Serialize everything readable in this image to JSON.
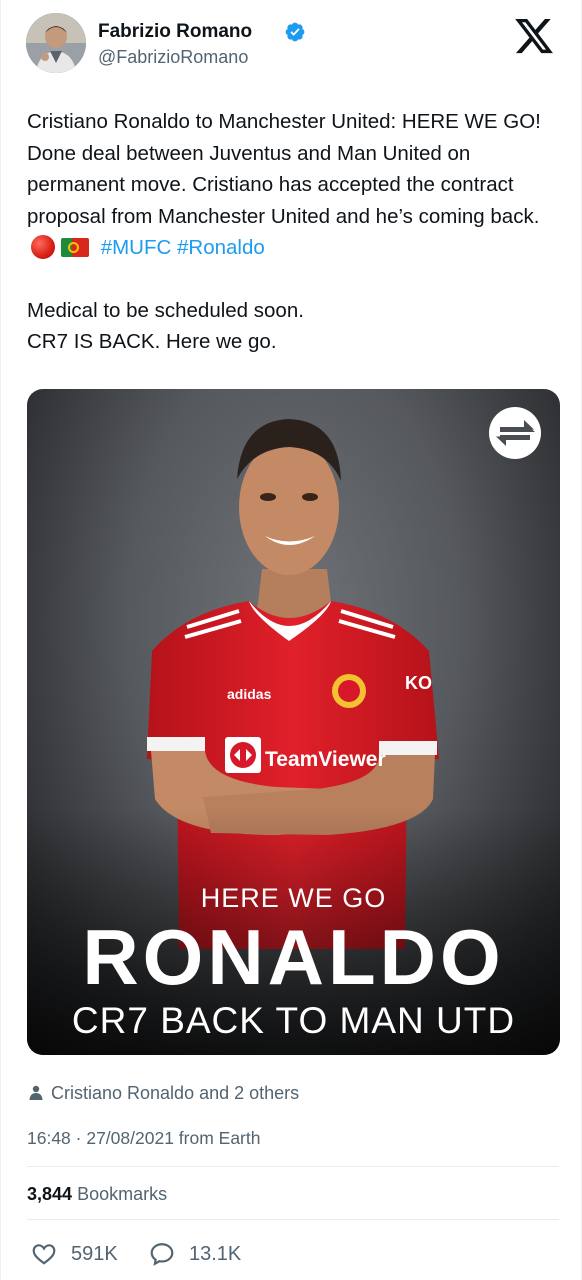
{
  "author": {
    "name": "Fabrizio Romano",
    "handle": "@FabrizioRomano",
    "verified": true
  },
  "logo": "x-logo-icon",
  "tweet": {
    "line1": "Cristiano Ronaldo to Manchester United: HERE WE GO! Done deal between Juventus and Man United on permanent move. Cristiano has accepted the contract proposal from Manchester United and he’s coming back.",
    "hashtags": [
      "#MUFC",
      "#Ronaldo"
    ],
    "line2": "Medical to be scheduled soon.",
    "line3": "CR7 IS BACK. Here we go."
  },
  "media": {
    "subtitle": "HERE WE GO",
    "headline": "RONALDO",
    "tagline": "CR7 BACK TO MAN UTD",
    "badge_icon": "transfer-arrows-icon",
    "shirt_sponsor": "TeamViewer",
    "shirt_brand": "adidas",
    "shirt_sleeve": "KO"
  },
  "meta": {
    "tagged": "Cristiano Ronaldo and 2 others",
    "timestamp": "16:48 · 27/08/2021 from Earth",
    "bookmarks_count": "3,844",
    "bookmarks_label": "Bookmarks"
  },
  "actions": {
    "likes": "591K",
    "replies": "13.1K"
  },
  "colors": {
    "accent": "#1d9bf0",
    "text": "#0f1419",
    "secondary": "#536471",
    "shirt_red": "#d71920"
  }
}
